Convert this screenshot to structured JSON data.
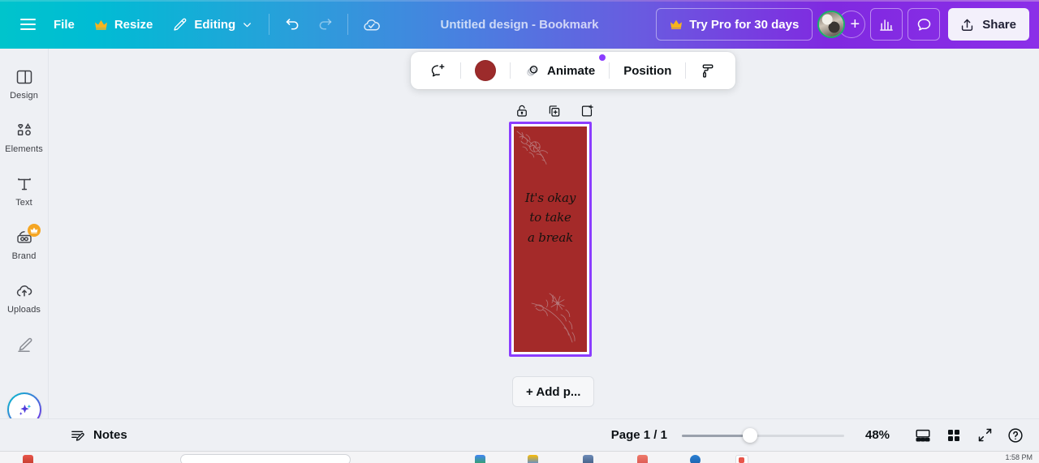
{
  "app": {
    "name": "Canva Editor"
  },
  "header": {
    "menu_icon": "hamburger-icon",
    "file_label": "File",
    "resize_label": "Resize",
    "resize_icon": "crown-icon",
    "editing_label": "Editing",
    "editing_icon": "pencil-icon",
    "chevron_icon": "chevron-down-icon",
    "undo_icon": "undo-arrow-icon",
    "redo_icon": "redo-arrow-icon",
    "cloud_icon": "cloud-saved-icon",
    "doc_title": "Untitled design - Bookmark",
    "try_pro_label": "Try Pro for 30 days",
    "try_pro_icon": "crown-icon",
    "avatar_name": "user-avatar",
    "add_people_label": "+",
    "insights_icon": "bar-chart-icon",
    "comments_icon": "comment-bubble-icon",
    "share_label": "Share",
    "share_icon": "share-upload-icon",
    "gradient_start": "#00c4cc",
    "gradient_mid": "#4a7fe0",
    "gradient_end": "#8b2fe8"
  },
  "sidebar": {
    "items": [
      {
        "label": "Design",
        "icon": "design-panel-icon",
        "badge": ""
      },
      {
        "label": "Elements",
        "icon": "shapes-icon",
        "badge": ""
      },
      {
        "label": "Text",
        "icon": "text-t-icon",
        "badge": ""
      },
      {
        "label": "Brand",
        "icon": "brand-kit-icon",
        "badge": "crown-icon"
      },
      {
        "label": "Uploads",
        "icon": "cloud-upload-icon",
        "badge": ""
      },
      {
        "label": "",
        "icon": "draw-pen-icon",
        "badge": ""
      }
    ],
    "ai_button": {
      "icon": "magic-sparkle-icon",
      "name": "magic-studio-button"
    }
  },
  "element_toolbar": {
    "comment_icon": "add-comment-icon",
    "color_swatch": {
      "name": "color-swatch",
      "value": "#9c2b2b"
    },
    "animate_label": "Animate",
    "animate_icon": "animate-shapes-icon",
    "animate_badge_color": "#8b3dff",
    "position_label": "Position",
    "paint_icon": "paint-roller-icon"
  },
  "page_tools": {
    "lock_icon": "unlock-icon",
    "duplicate_icon": "duplicate-page-icon",
    "add_icon": "add-page-icon"
  },
  "canvas": {
    "page_background": "#a42a29",
    "selection_color": "#8b3dff",
    "quote_lines": [
      "It's okay",
      "to take",
      "a break"
    ],
    "floral_top_left": "floral-branch-icon",
    "floral_bottom_right": "floral-branch-icon",
    "add_page_label": "+ Add p..."
  },
  "bottom_bar": {
    "notes_label": "Notes",
    "notes_icon": "notes-pencil-icon",
    "page_indicator": "Page 1 / 1",
    "zoom_level": "48%",
    "zoom_slider_percent": 42,
    "grid_view_icon": "page-view-icon",
    "thumbnails_icon": "grid-view-icon",
    "fullscreen_icon": "expand-arrows-icon",
    "help_icon": "help-question-icon"
  },
  "taskbar": {
    "time": "1:58 PM"
  }
}
